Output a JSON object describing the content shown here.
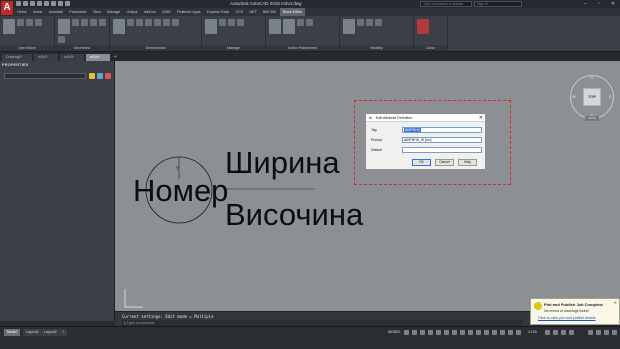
{
  "app": {
    "title": "Autodesk AutoCAD 2018   m3v4.dwg",
    "search_placeholder": "Type a keyword or phrase",
    "sign_in": "Sign In",
    "logo_letter": "A"
  },
  "ribbon": {
    "tabs": [
      "Home",
      "Insert",
      "Annotate",
      "Parametric",
      "View",
      "Manage",
      "Output",
      "Add-ins",
      "A360",
      "Featured Apps",
      "Express Tools",
      "CCS",
      "NET",
      "BIM 360",
      "Block Editor"
    ],
    "active_tab": "Block Editor",
    "panels": [
      "Open/Save",
      "Geometric",
      "Dimensional",
      "Manage",
      "Action Parameters",
      "Visibility",
      "Close"
    ]
  },
  "doc_tabs": {
    "items": [
      "Drawing1*",
      "m3v2*",
      "m3v3*",
      "m3v4*"
    ],
    "active_index": 3,
    "plus": "+"
  },
  "properties": {
    "title": "PROPERTIES"
  },
  "canvas": {
    "background": "#8c8f93",
    "attr_number": "Номер",
    "attr_width": "Ширина",
    "attr_height": "Височина",
    "ucs_y": "Y",
    "viewcube": {
      "top": "TOP",
      "n": "N",
      "s": "S",
      "e": "E",
      "w": "W",
      "wcs": "WCS"
    }
  },
  "dialog": {
    "title": "Edit Attribute Definition",
    "tag_label": "Tag",
    "tag_value": "ШИРИНА",
    "prompt_label": "Prompt",
    "prompt_value": "ШИРИНА_W [cm]",
    "default_label": "Default",
    "default_value": "",
    "ok": "OK",
    "cancel": "Cancel",
    "help": "Help"
  },
  "command": {
    "history": "Current settings: Edit mode = Multiple",
    "prompt": "Type a command"
  },
  "statusbar": {
    "layout_tabs": [
      "Model",
      "Layout1",
      "Layout2"
    ],
    "active_layout": "Model",
    "model_label": "MODEL",
    "scale": "1:100"
  },
  "notification": {
    "title": "Plot and Publish Job Complete",
    "message": "No errors or warnings found",
    "link": "Click to view plot and publish details"
  },
  "colors": {
    "accent_red": "#c0282a",
    "dialog_frame": "#d52b2b",
    "selection_blue": "#3a6fd8"
  }
}
